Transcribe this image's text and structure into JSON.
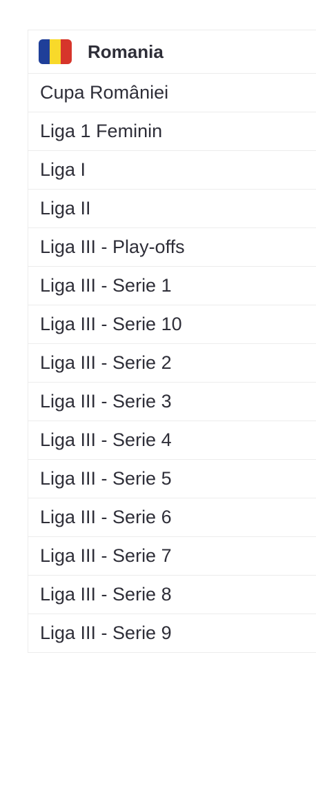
{
  "country": {
    "name": "Romania",
    "flag_icon": "romania-flag-icon",
    "flag_colors": [
      "#1f3f99",
      "#f8d92a",
      "#d6352b"
    ]
  },
  "leagues": [
    {
      "label": "Cupa României"
    },
    {
      "label": "Liga 1 Feminin"
    },
    {
      "label": "Liga I"
    },
    {
      "label": "Liga II"
    },
    {
      "label": "Liga III - Play-offs"
    },
    {
      "label": "Liga III - Serie 1"
    },
    {
      "label": "Liga III - Serie 10"
    },
    {
      "label": "Liga III - Serie 2"
    },
    {
      "label": "Liga III - Serie 3"
    },
    {
      "label": "Liga III - Serie 4"
    },
    {
      "label": "Liga III - Serie 5"
    },
    {
      "label": "Liga III - Serie 6"
    },
    {
      "label": "Liga III - Serie 7"
    },
    {
      "label": "Liga III - Serie 8"
    },
    {
      "label": "Liga III - Serie 9"
    }
  ]
}
